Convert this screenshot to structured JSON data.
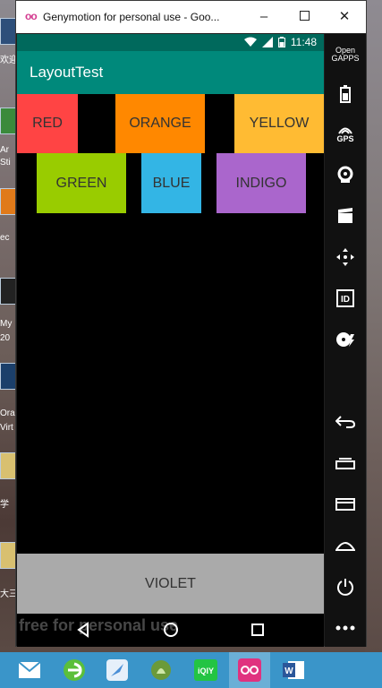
{
  "window": {
    "title": "Genymotion for personal use - Goo...",
    "logo": "oo"
  },
  "statusbar": {
    "time": "11:48"
  },
  "app": {
    "title": "LayoutTest"
  },
  "colors": {
    "red": {
      "label": "RED",
      "color": "#ff4444"
    },
    "orange": {
      "label": "ORANGE",
      "color": "#ff8800"
    },
    "yellow": {
      "label": "YELLOW",
      "color": "#ffbb33"
    },
    "green": {
      "label": "GREEN",
      "color": "#99cc00"
    },
    "blue": {
      "label": "BLUE",
      "color": "#33b5e5"
    },
    "indigo": {
      "label": "INDIGO",
      "color": "#aa66cc"
    },
    "violet": {
      "label": "VIOLET",
      "color": "#aaaaaa"
    }
  },
  "watermark": "free for personal use",
  "sidebar": {
    "items": [
      {
        "name": "opengapps-icon",
        "label": "Open GAPPS"
      },
      {
        "name": "battery-icon"
      },
      {
        "name": "gps-icon",
        "label": "GPS"
      },
      {
        "name": "webcam-icon"
      },
      {
        "name": "capture-icon"
      },
      {
        "name": "dpad-icon"
      },
      {
        "name": "identifiers-icon",
        "label": "ID"
      },
      {
        "name": "disk-icon"
      },
      {
        "name": "back-icon"
      },
      {
        "name": "recent-apps-icon"
      },
      {
        "name": "menu-icon"
      },
      {
        "name": "home-icon"
      },
      {
        "name": "power-icon"
      },
      {
        "name": "more-icon"
      }
    ]
  },
  "desktop": {
    "labels": [
      "欢迎",
      "Ar",
      "Sti",
      "ec",
      "My",
      "20",
      "Ora",
      "Virt",
      "学",
      "大三"
    ]
  }
}
